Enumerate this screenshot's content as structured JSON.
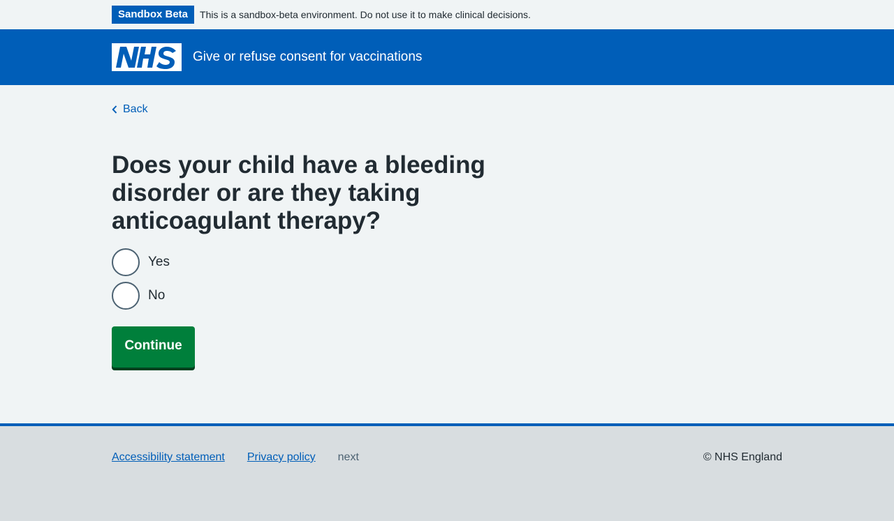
{
  "phase_banner": {
    "tag": "Sandbox Beta",
    "text": "This is a sandbox-beta environment. Do not use it to make clinical decisions."
  },
  "header": {
    "logo_text": "NHS",
    "service_name": "Give or refuse consent for vaccinations"
  },
  "colors": {
    "brand_blue": "#005eb8",
    "button_green": "#007f3b",
    "text": "#212b32",
    "background": "#f0f4f5",
    "footer_bg": "#d8dde0"
  },
  "back_link": {
    "icon": "chevron-left-icon",
    "label": "Back"
  },
  "form": {
    "question": "Does your child have a bleeding disorder or are they taking anticoagulant therapy?",
    "options": [
      {
        "label": "Yes",
        "selected": false
      },
      {
        "label": "No",
        "selected": false
      }
    ],
    "submit_label": "Continue"
  },
  "footer": {
    "links": [
      {
        "label": "Accessibility statement"
      },
      {
        "label": "Privacy policy"
      }
    ],
    "muted_text": "next",
    "copyright": "© NHS England"
  }
}
